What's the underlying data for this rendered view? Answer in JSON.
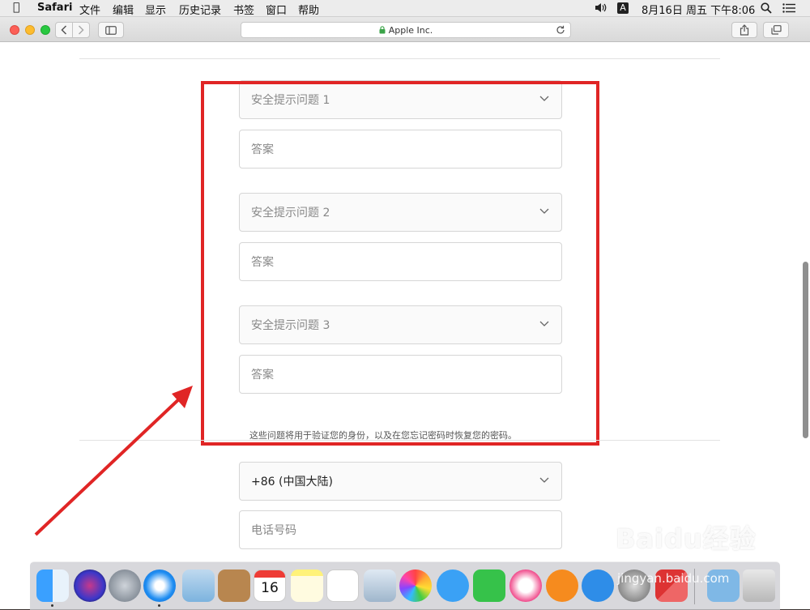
{
  "menubar": {
    "apple_icon": "apple-icon",
    "app_name": "Safari",
    "items": [
      "文件",
      "编辑",
      "显示",
      "历史记录",
      "书签",
      "窗口",
      "帮助"
    ],
    "input_badge": "A",
    "datetime": "8月16日 周五 下午8:06"
  },
  "toolbar": {
    "url": "Apple Inc.",
    "lock_icon": "lock-icon"
  },
  "form": {
    "questions": [
      {
        "select_label": "安全提示问题 1",
        "answer_placeholder": "答案"
      },
      {
        "select_label": "安全提示问题 2",
        "answer_placeholder": "答案"
      },
      {
        "select_label": "安全提示问题 3",
        "answer_placeholder": "答案"
      }
    ],
    "hint": "这些问题将用于验证您的身份，以及在您忘记密码时恢复您的密码。",
    "country_code": "+86 (中国大陆)",
    "phone_placeholder": "电话号码"
  },
  "highlight_color": "#e02525",
  "watermark": {
    "logo": "Baidu经验",
    "url": "jingyan.baidu.com"
  },
  "dock": {
    "calendar_day": "16",
    "apps": [
      "finder",
      "siri",
      "launchpad",
      "safari",
      "mail",
      "contacts",
      "calendar",
      "notes",
      "reminders",
      "preview",
      "photos",
      "messages",
      "facetime",
      "itunes",
      "ibooks",
      "app-store",
      "system-preferences",
      "parallels",
      "downloads",
      "trash"
    ]
  }
}
